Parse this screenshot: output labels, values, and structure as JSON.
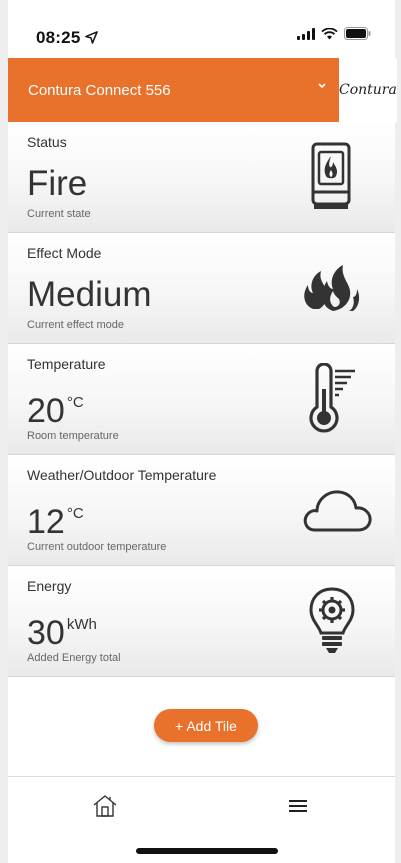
{
  "status_bar": {
    "time": "08:25",
    "location_icon": "location-arrow-icon",
    "signal_icon": "signal-icon",
    "wifi_icon": "wifi-icon",
    "battery_icon": "battery-icon"
  },
  "header": {
    "device_name": "Contura Connect 556",
    "dropdown_icon": "chevron-down-icon",
    "brand": "Contura",
    "accent_color": "#e8722b"
  },
  "tiles": [
    {
      "title": "Status",
      "value": "Fire",
      "unit": "",
      "subtitle": "Current state",
      "icon": "stove-fire-icon"
    },
    {
      "title": "Effect Mode",
      "value": "Medium",
      "unit": "",
      "subtitle": "Current effect mode",
      "icon": "flames-icon"
    },
    {
      "title": "Temperature",
      "value": "20",
      "unit": "°C",
      "subtitle": "Room temperature",
      "icon": "thermometer-icon"
    },
    {
      "title": "Weather/Outdoor Temperature",
      "value": "12",
      "unit": "°C",
      "subtitle": "Current outdoor temperature",
      "icon": "cloud-icon"
    },
    {
      "title": "Energy",
      "value": "30",
      "unit": "kWh",
      "subtitle": "Added Energy total",
      "icon": "lightbulb-gear-icon"
    }
  ],
  "add_tile": {
    "label": "+ Add Tile"
  },
  "nav": {
    "home_icon": "home-icon",
    "menu_icon": "menu-icon"
  }
}
